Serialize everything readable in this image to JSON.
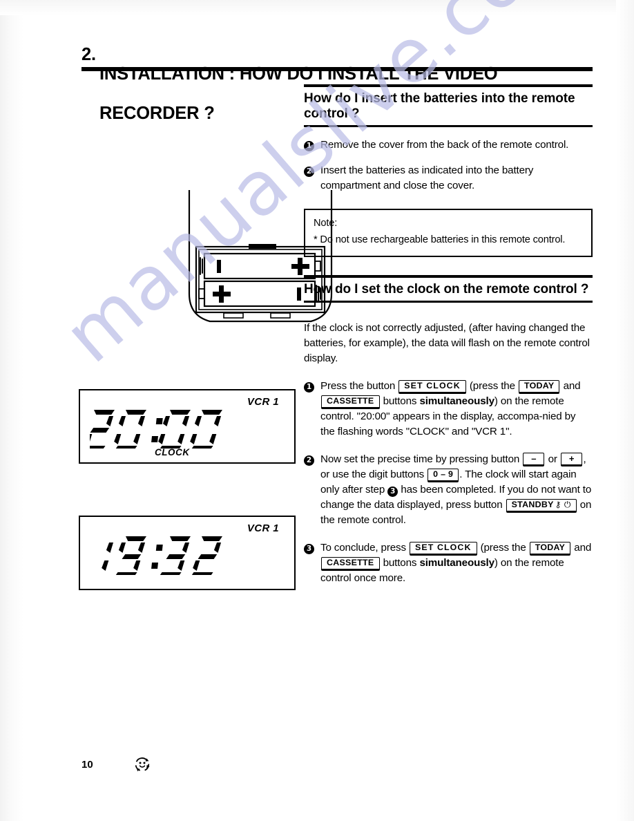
{
  "document": {
    "chapter_number": "2.",
    "chapter_title_line1": "INSTALLATION : HOW DO I INSTALL THE VIDEO",
    "chapter_title_line2": "RECORDER ?",
    "page_number": "10",
    "watermark": "manualslive.com",
    "footer_icon_name": "smiley-recycle-icon"
  },
  "section_batteries": {
    "heading": "How do I insert the batteries into the remote control ?",
    "steps": [
      {
        "number": "1",
        "text": "Remove the cover from the back of the remote control."
      },
      {
        "number": "2",
        "text": "Insert the batteries as indicated into the battery compartment and close the cover."
      }
    ],
    "note": {
      "title": "Note:",
      "body": "* Do not use rechargeable batteries in this remote control."
    }
  },
  "section_clock": {
    "heading": "How do I set the clock on the remote control ?",
    "intro": "If the clock is not correctly adjusted, (after having changed the batteries, for example), the data will flash on the remote control display.",
    "step1": {
      "number": "1",
      "t1": "Press the button",
      "key_set_clock": "SET CLOCK",
      "t2": "(press the",
      "key_today": "TODAY",
      "t3": "and",
      "key_cassette": "CASSETTE",
      "t4": "buttons",
      "emphasis": "simultaneously",
      "t5": ") on the remote control. \"20:00\" appears in the display, accompa-nied by the flashing words \"CLOCK\" and \"VCR 1\"."
    },
    "step2": {
      "number": "2",
      "t1": "Now set the precise time by pressing button",
      "key_minus": "–",
      "t2": "or",
      "key_plus": "+",
      "t3": ", or use the digit buttons",
      "key_digits": "0 – 9",
      "t4": ". The clock will start again only after step",
      "step_ref": "3",
      "t5": "has been completed.",
      "t6": "If you do not want to change the data displayed, press button",
      "key_standby": "STANDBY",
      "key_standby_glyphs": "⚷ ⏻",
      "t7": "on the remote control."
    },
    "step3": {
      "number": "3",
      "t1": "To conclude, press",
      "key_set_clock": "SET CLOCK",
      "t2": "(press the",
      "key_today": "TODAY",
      "t3": "and",
      "key_cassette": "CASSETTE",
      "t4": "buttons",
      "emphasis": "simultaneously",
      "t5": ") on the remote control once more."
    }
  },
  "illustration_remote": {
    "name": "remote-control-battery-compartment",
    "battery_top_minus": "I",
    "battery_top_plus": "+",
    "battery_bottom_plus": "+",
    "battery_bottom_minus": "I"
  },
  "display_1": {
    "name": "lcd-display-clock-set",
    "vcr_label": "VCR 1",
    "time": "20:00",
    "clock_label": "CLOCK"
  },
  "display_2": {
    "name": "lcd-display-clock-adjusted",
    "vcr_label": "VCR 1",
    "time": "19:32"
  }
}
